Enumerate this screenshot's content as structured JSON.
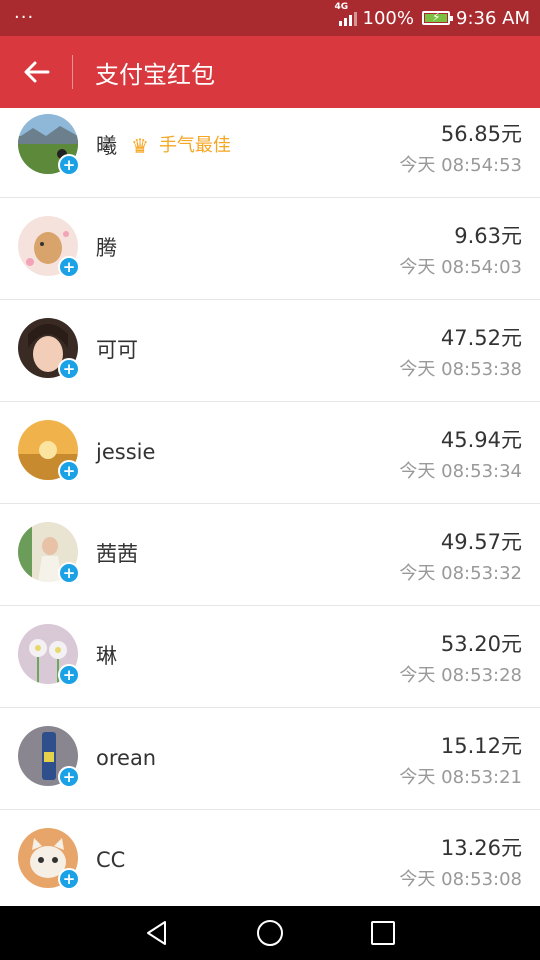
{
  "status_bar": {
    "menu_dots": "···",
    "network": "4G",
    "battery_pct": "100%",
    "time": "9:36 AM"
  },
  "app_bar": {
    "title": "支付宝红包"
  },
  "best_badge": "手气最佳",
  "items": [
    {
      "name": "曦",
      "amount": "56.85元",
      "time": "今天 08:54:53",
      "best": true
    },
    {
      "name": "腾",
      "amount": "9.63元",
      "time": "今天 08:54:03",
      "best": false
    },
    {
      "name": "可可",
      "amount": "47.52元",
      "time": "今天 08:53:38",
      "best": false
    },
    {
      "name": "jessie",
      "amount": "45.94元",
      "time": "今天 08:53:34",
      "best": false
    },
    {
      "name": "茜茜",
      "amount": "49.57元",
      "time": "今天 08:53:32",
      "best": false
    },
    {
      "name": "琳",
      "amount": "53.20元",
      "time": "今天 08:53:28",
      "best": false
    },
    {
      "name": "orean",
      "amount": "15.12元",
      "time": "今天 08:53:21",
      "best": false
    },
    {
      "name": "CC",
      "amount": "13.26元",
      "time": "今天 08:53:08",
      "best": false
    }
  ],
  "colors": {
    "status_bar": "#a92a2f",
    "app_bar": "#d9383e",
    "best": "#f5a623",
    "add_badge": "#1aa1e6"
  }
}
